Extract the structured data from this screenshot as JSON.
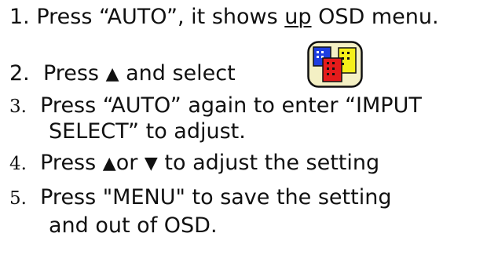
{
  "steps": [
    {
      "number": "1.",
      "text_a": " Press “AUTO”, it shows ",
      "text_underlined": "up",
      "text_b": " OSD menu."
    },
    {
      "number": "2.",
      "text_a": "Press ",
      "up_symbol": "▲",
      "text_b": " and select"
    },
    {
      "number": "3.",
      "line1": "Press “AUTO” again to enter “IMPUT",
      "line2": "SELECT” to adjust."
    },
    {
      "number": "4.",
      "text_a": "Press ",
      "up_symbol": "▲",
      "text_b": "or ",
      "down_symbol": "▼",
      "text_c": " to adjust the setting"
    },
    {
      "number": "5.",
      "line1": "Press \"MENU\" to save the setting",
      "line2": "and out of OSD."
    }
  ],
  "icon": "input-select-buildings-icon",
  "colors": {
    "text": "#111111",
    "icon_blue": "#1f3ee0",
    "icon_red": "#e51b1b",
    "icon_yellow": "#f5ef1a",
    "icon_frame": "#f4f0c4"
  }
}
